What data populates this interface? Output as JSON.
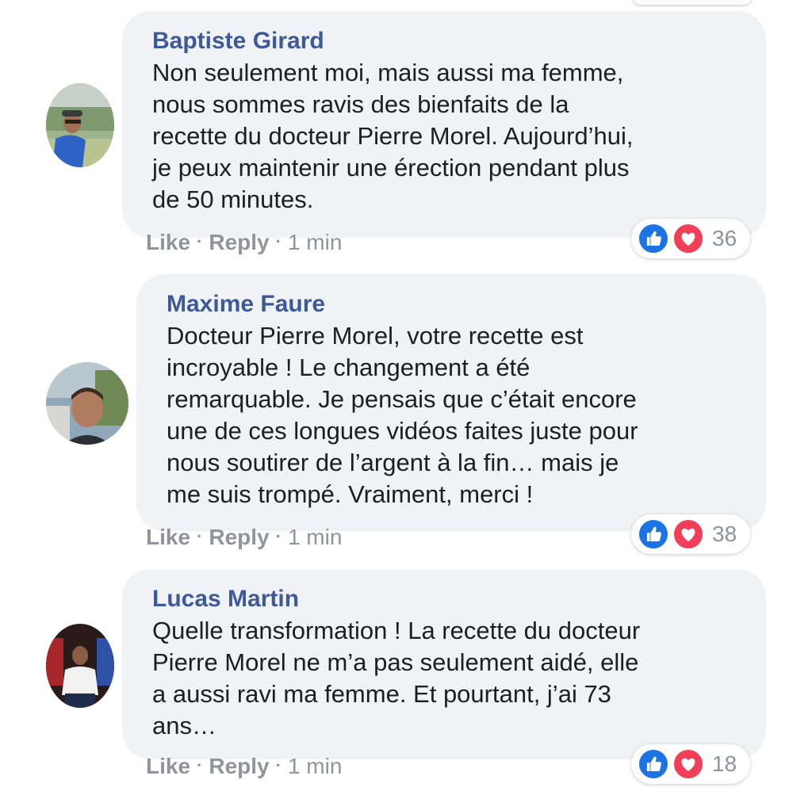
{
  "comments": [
    {
      "author": "Baptiste Girard",
      "text_lines": [
        "Non seulement moi, mais aussi ma femme,",
        "nous sommes ravis des bienfaits de la",
        "recette du docteur Pierre Morel. Aujourd’hui,",
        "je peux maintenir une érection pendant plus",
        "de 50 minutes."
      ],
      "like_label": "Like",
      "reply_label": "Reply",
      "time": "1 min",
      "separator": "·",
      "reaction_count": "36",
      "avatar_icon": "avatar-man-cap-sunglasses"
    },
    {
      "author": "Maxime Faure",
      "text_lines": [
        "Docteur Pierre Morel, votre recette est",
        "incroyable ! Le changement a été",
        "remarquable. Je pensais que c’était encore",
        "une de ces longues vidéos faites juste pour",
        "nous soutirer de l’argent à la fin… mais je",
        "me suis trompé. Vraiment, merci !"
      ],
      "like_label": "Like",
      "reply_label": "Reply",
      "time": "1 min",
      "separator": "·",
      "reaction_count": "38",
      "avatar_icon": "avatar-man-outdoors"
    },
    {
      "author": "Lucas Martin",
      "text_lines": [
        "Quelle transformation ! La recette du docteur",
        "Pierre Morel ne m’a pas seulement aidé, elle",
        "a aussi ravi ma femme. Et pourtant, j’ai 73",
        "ans…"
      ],
      "like_label": "Like",
      "reply_label": "Reply",
      "time": "1 min",
      "separator": "·",
      "reaction_count": "18",
      "avatar_icon": "avatar-man-white-shirt"
    }
  ],
  "colors": {
    "author": "#3d5a98",
    "bubble": "#f1f2f5",
    "like": "#1b74e4",
    "love": "#f33e58",
    "meta": "#90949c"
  }
}
